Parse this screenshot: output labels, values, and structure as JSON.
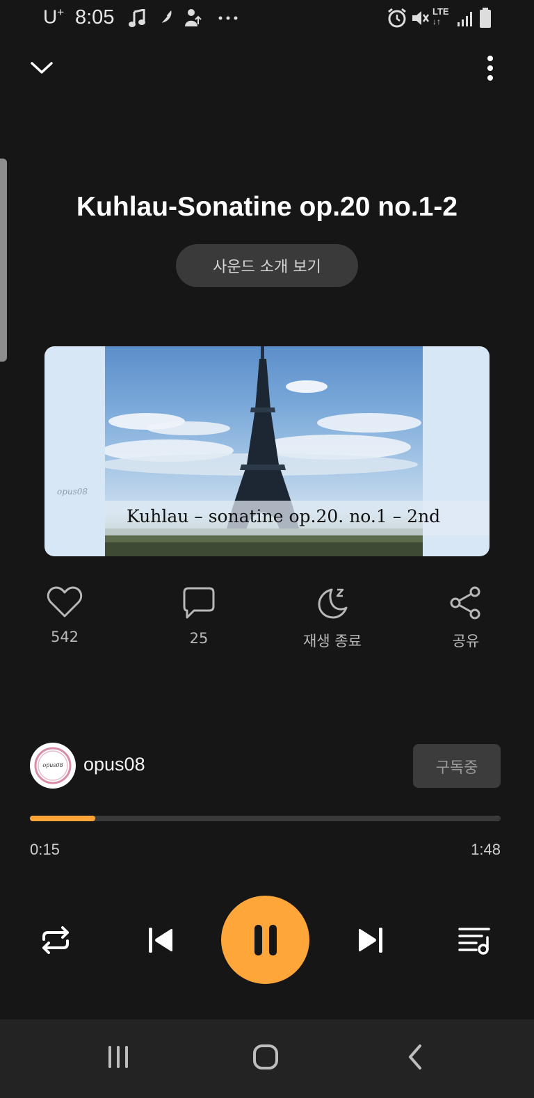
{
  "status_bar": {
    "carrier": "U",
    "carrier_sup": "+",
    "time": "8:05",
    "notification_icons": [
      "music-note-icon",
      "feather-icon",
      "upload-icon",
      "more-dots-icon"
    ],
    "system_icons": [
      "alarm-icon",
      "mute-icon",
      "lte-icon",
      "signal-icon",
      "battery-icon"
    ],
    "network": "LTE"
  },
  "player": {
    "title": "Kuhlau-Sonatine op.20 no.1-2",
    "intro_button": "사운드 소개 보기",
    "artwork": {
      "watermark": "opus08",
      "caption": "Kuhlau – sonatine op.20. no.1 – 2nd"
    },
    "actions": {
      "like_count": "542",
      "comment_count": "25",
      "sleep_label": "재생 종료",
      "share_label": "공유"
    },
    "creator": {
      "name": "opus08",
      "avatar_text": "opus08",
      "subscribe_label": "구독중"
    },
    "progress": {
      "current": "0:15",
      "total": "1:48",
      "fraction": 0.139
    }
  },
  "colors": {
    "accent": "#ffa63a",
    "background": "#161616",
    "button_bg": "#3a3a3a"
  }
}
